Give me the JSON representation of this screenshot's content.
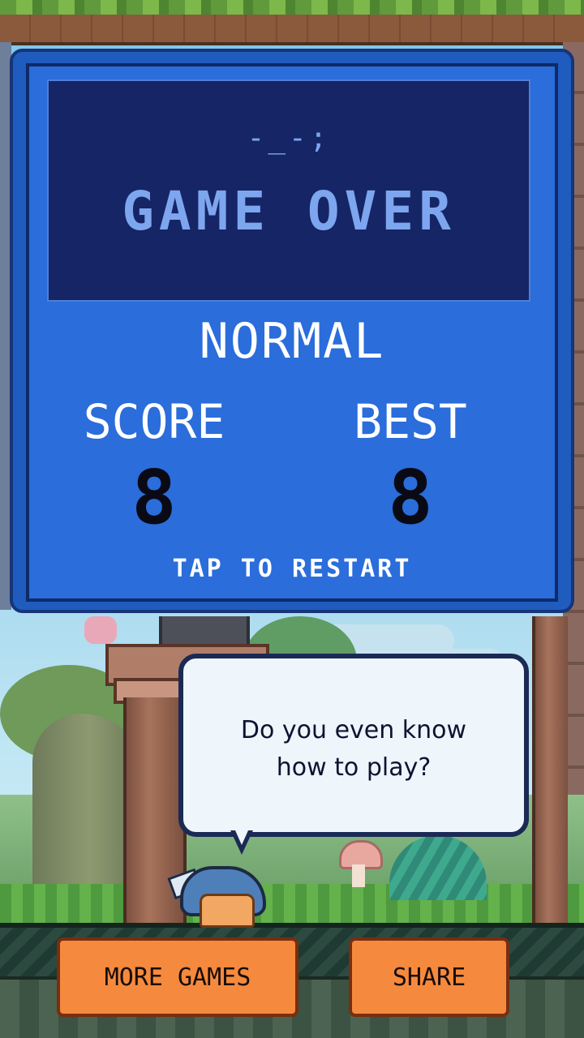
{
  "panel": {
    "emote": "-_-;",
    "title": "GAME OVER",
    "mode": "NORMAL",
    "score_label": "SCORE",
    "score_value": "8",
    "best_label": "BEST",
    "best_value": "8",
    "restart_label": "TAP TO RESTART"
  },
  "speech": {
    "line1": "Do you even know",
    "line2": "how to play?"
  },
  "buttons": {
    "more_games": "MORE GAMES",
    "share": "SHARE"
  },
  "colors": {
    "panel_blue": "#2a6ddb",
    "title_box": "#162565",
    "title_text": "#7da6ef",
    "button_orange": "#f58a3f"
  }
}
